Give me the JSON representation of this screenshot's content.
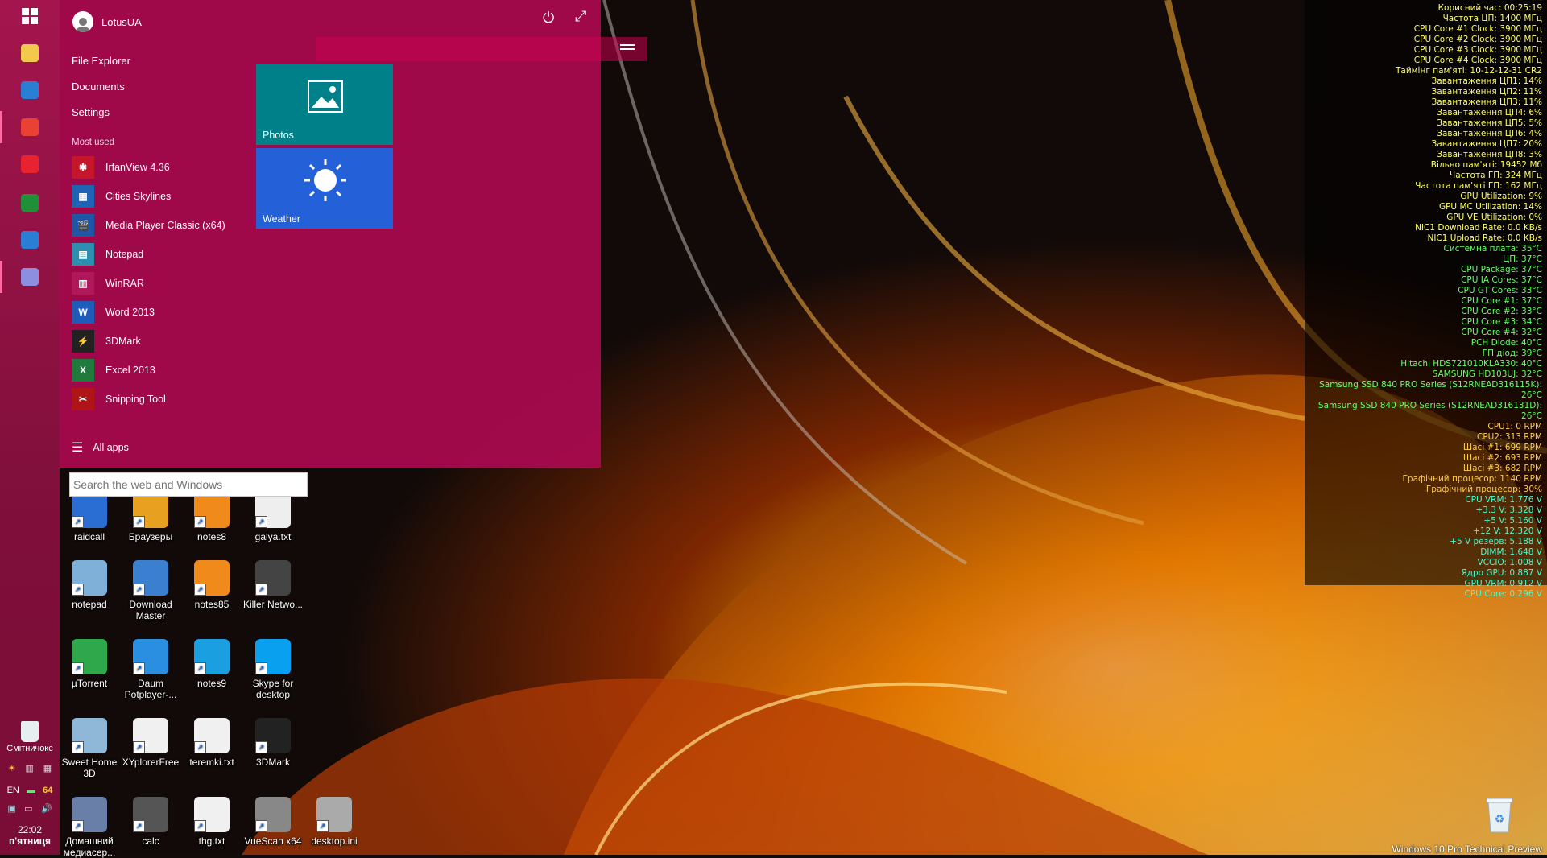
{
  "taskbar": {
    "pinned": [
      {
        "name": "file-explorer-pin-icon",
        "color": "#f2c94c"
      },
      {
        "name": "ie-pin-icon",
        "color": "#2a7fd4"
      },
      {
        "name": "chrome-pin-icon",
        "color": "#e94235"
      },
      {
        "name": "splat-pin-icon",
        "color": "#e8222f"
      },
      {
        "name": "excel-pin-icon",
        "color": "#1f8f3a"
      },
      {
        "name": "moon-pin-icon",
        "color": "#2a7fd4"
      },
      {
        "name": "media-pin-icon",
        "color": "#8e8ee0"
      }
    ],
    "recycle_label": "Смітничокс",
    "lang": "EN",
    "tray_badge": "64",
    "time": "22:02",
    "day": "п'ятниця"
  },
  "start_menu": {
    "user_name": "LotusUA",
    "links": [
      "File Explorer",
      "Documents",
      "Settings"
    ],
    "section_most_used": "Most used",
    "apps": [
      {
        "label": "IrfanView 4.36",
        "color": "#c5172c",
        "glyph": "✱",
        "icon": "irfanview-icon"
      },
      {
        "label": "Cities Skylines",
        "color": "#1e64b4",
        "glyph": "▦",
        "icon": "cities-skylines-icon"
      },
      {
        "label": "Media Player Classic (x64)",
        "color": "#1e56a8",
        "glyph": "🎬",
        "icon": "mpc-icon"
      },
      {
        "label": "Notepad",
        "color": "#2c8fb0",
        "glyph": "▤",
        "icon": "notepad-icon"
      },
      {
        "label": "WinRAR",
        "color": "#b0185c",
        "glyph": "▥",
        "icon": "winrar-icon"
      },
      {
        "label": "Word 2013",
        "color": "#1f5bb8",
        "glyph": "W",
        "icon": "word-icon"
      },
      {
        "label": "3DMark",
        "color": "#222222",
        "glyph": "⚡",
        "icon": "3dmark-icon"
      },
      {
        "label": "Excel 2013",
        "color": "#1e7b3c",
        "glyph": "X",
        "icon": "excel-icon"
      },
      {
        "label": "Snipping Tool",
        "color": "#b01515",
        "glyph": "✂",
        "icon": "snipping-tool-icon"
      }
    ],
    "all_apps": "All apps",
    "tiles": [
      {
        "label": "Photos",
        "color": "#00818a"
      },
      {
        "label": "Weather",
        "color": "#2461d8"
      }
    ]
  },
  "search": {
    "placeholder": "Search the web and Windows"
  },
  "desktop_icons": [
    {
      "label": "raidcall",
      "icon": "raidcall-icon"
    },
    {
      "label": "Браузеры",
      "icon": "browsers-icon"
    },
    {
      "label": "notes8",
      "icon": "notes8-icon"
    },
    {
      "label": "galya.txt",
      "icon": "galya-file-icon"
    },
    {
      "label": "notepad",
      "icon": "notepad-desktop-icon"
    },
    {
      "label": "Download Master",
      "icon": "download-master-icon"
    },
    {
      "label": "notes85",
      "icon": "notes85-icon"
    },
    {
      "label": "Killer Netwo...",
      "icon": "killer-network-icon"
    },
    {
      "label": "µTorrent",
      "icon": "utorrent-icon"
    },
    {
      "label": "Daum Potplayer-...",
      "icon": "potplayer-icon"
    },
    {
      "label": "notes9",
      "icon": "notes9-icon"
    },
    {
      "label": "Skype for desktop",
      "icon": "skype-icon"
    },
    {
      "label": "Sweet Home 3D",
      "icon": "sweet-home-3d-icon"
    },
    {
      "label": "XYplorerFree",
      "icon": "xyplorer-icon"
    },
    {
      "label": "teremki.txt",
      "icon": "teremki-file-icon"
    },
    {
      "label": "3DMark",
      "icon": "3dmark-desktop-icon"
    },
    {
      "label": "Домашний медиасер...",
      "icon": "media-server-icon"
    },
    {
      "label": "calc",
      "icon": "calc-icon"
    },
    {
      "label": "thg.txt",
      "icon": "thg-file-icon"
    },
    {
      "label": "VueScan x64",
      "icon": "vuescan-icon"
    },
    {
      "label": "desktop.ini",
      "icon": "desktop-ini-icon"
    }
  ],
  "sensors": [
    {
      "t": "Корисний час: 00:25:19",
      "c": "#ffff66"
    },
    {
      "t": "Частота ЦП: 1400 МГц",
      "c": "#ffff66"
    },
    {
      "t": "CPU Core #1 Clock: 3900 МГц",
      "c": "#ffff66"
    },
    {
      "t": "CPU Core #2 Clock: 3900 МГц",
      "c": "#ffff66"
    },
    {
      "t": "CPU Core #3 Clock: 3900 МГц",
      "c": "#ffff66"
    },
    {
      "t": "CPU Core #4 Clock: 3900 МГц",
      "c": "#ffff66"
    },
    {
      "t": "Таймінг пам'яті: 10-12-12-31 CR2",
      "c": "#ffff66"
    },
    {
      "t": "Завантаження ЦП1: 14%",
      "c": "#ffff66"
    },
    {
      "t": "Завантаження ЦП2: 11%",
      "c": "#ffff66"
    },
    {
      "t": "Завантаження ЦП3: 11%",
      "c": "#ffff66"
    },
    {
      "t": "Завантаження ЦП4: 6%",
      "c": "#ffff66"
    },
    {
      "t": "Завантаження ЦП5: 5%",
      "c": "#ffff66"
    },
    {
      "t": "Завантаження ЦП6: 4%",
      "c": "#ffff66"
    },
    {
      "t": "Завантаження ЦП7: 20%",
      "c": "#ffff66"
    },
    {
      "t": "Завантаження ЦП8: 3%",
      "c": "#ffff66"
    },
    {
      "t": "Вільно пам'яті: 19452 Мб",
      "c": "#ffff66"
    },
    {
      "t": "Частота ГП: 324 МГц",
      "c": "#ffff66"
    },
    {
      "t": "Частота пам'яті ГП: 162 МГц",
      "c": "#ffff66"
    },
    {
      "t": "GPU Utilization: 9%",
      "c": "#ffff66"
    },
    {
      "t": "GPU MC Utilization: 14%",
      "c": "#ffff66"
    },
    {
      "t": "GPU VE Utilization: 0%",
      "c": "#ffff66"
    },
    {
      "t": "NIC1 Download Rate: 0.0 KB/s",
      "c": "#ffff66"
    },
    {
      "t": "NIC1 Upload Rate: 0.0 KB/s",
      "c": "#ffff66"
    },
    {
      "t": "Системна плата: 35°C",
      "c": "#66ff66"
    },
    {
      "t": "ЦП: 37°C",
      "c": "#66ff66"
    },
    {
      "t": "CPU Package: 37°C",
      "c": "#66ff66"
    },
    {
      "t": "CPU IA Cores: 37°C",
      "c": "#66ff66"
    },
    {
      "t": "CPU GT Cores: 33°C",
      "c": "#66ff66"
    },
    {
      "t": "CPU Core #1: 37°C",
      "c": "#66ff66"
    },
    {
      "t": "CPU Core #2: 33°C",
      "c": "#66ff66"
    },
    {
      "t": "CPU Core #3: 34°C",
      "c": "#66ff66"
    },
    {
      "t": "CPU Core #4: 32°C",
      "c": "#66ff66"
    },
    {
      "t": "PCH Diode: 40°C",
      "c": "#66ff66"
    },
    {
      "t": "ГП діод: 39°C",
      "c": "#66ff66"
    },
    {
      "t": "Hitachi HDS721010KLA330: 40°C",
      "c": "#66ff66"
    },
    {
      "t": "SAMSUNG HD103UJ: 32°C",
      "c": "#66ff66"
    },
    {
      "t": "Samsung SSD 840 PRO Series (S12RNEAD316115K): 26°C",
      "c": "#66ff66"
    },
    {
      "t": "Samsung SSD 840 PRO Series (S12RNEAD316131D): 26°C",
      "c": "#66ff66"
    },
    {
      "t": "CPU1: 0 RPM",
      "c": "#ffcc44"
    },
    {
      "t": "CPU2: 313 RPM",
      "c": "#ffcc44"
    },
    {
      "t": "Шасі #1: 699 RPM",
      "c": "#ffcc44"
    },
    {
      "t": "Шасі #2: 693 RPM",
      "c": "#ffcc44"
    },
    {
      "t": "Шасі #3: 682 RPM",
      "c": "#ffcc44"
    },
    {
      "t": "Графічний процесор: 1140 RPM",
      "c": "#ffcc44"
    },
    {
      "t": "Графічний процесор: 30%",
      "c": "#ffcc44"
    },
    {
      "t": "CPU VRM: 1.776 V",
      "c": "#44ffcc"
    },
    {
      "t": "+3.3 V: 3.328 V",
      "c": "#44ffcc"
    },
    {
      "t": "+5 V: 5.160 V",
      "c": "#44ffcc"
    },
    {
      "t": "+12 V: 12.320 V",
      "c": "#44ffcc"
    },
    {
      "t": "+5 V резерв: 5.188 V",
      "c": "#44ffcc"
    },
    {
      "t": "DIMM: 1.648 V",
      "c": "#44ffcc"
    },
    {
      "t": "VCCIO: 1.008 V",
      "c": "#44ffcc"
    },
    {
      "t": "Ядро GPU: 0.887 V",
      "c": "#44ffcc"
    },
    {
      "t": "GPU VRM: 0.912 V",
      "c": "#44ffcc"
    },
    {
      "t": "CPU Core: 0.296 V",
      "c": "#44ffcc"
    }
  ],
  "watermark": "Windows 10 Pro Technical Preview"
}
